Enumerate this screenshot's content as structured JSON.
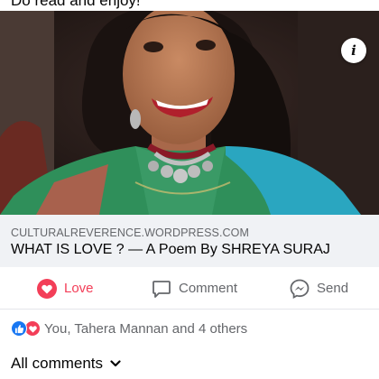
{
  "post": {
    "caption_fragment": "Do read and enjoy!"
  },
  "link": {
    "domain": "CULTURALREVERENCE.WORDPRESS.COM",
    "title": "WHAT IS LOVE ? — A Poem By SHREYA SURAJ"
  },
  "actions": {
    "love_label": "Love",
    "comment_label": "Comment",
    "send_label": "Send"
  },
  "reactions": {
    "summary": "You, Tahera Mannan and 4 others",
    "icons": [
      "like-icon",
      "heart-icon"
    ]
  },
  "comments": {
    "filter_label": "All comments"
  },
  "colors": {
    "love_red": "#f33e58",
    "like_blue": "#1877f2",
    "muted_text": "#65676b",
    "link_box_bg": "#f0f2f5"
  }
}
